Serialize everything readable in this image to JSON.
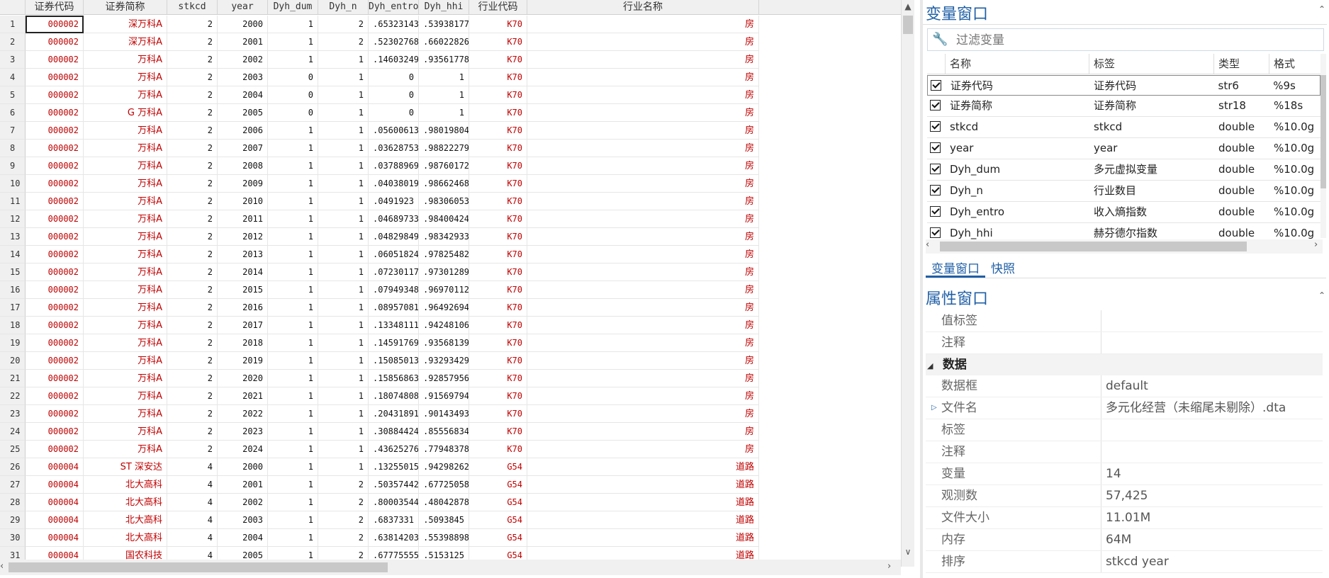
{
  "data_grid": {
    "columns": [
      "",
      "证券代码",
      "证券简称",
      "stkcd",
      "year",
      "Dyh_dum",
      "Dyh_n",
      "Dyh_entro",
      "Dyh_hhi",
      "行业代码",
      "行业名称"
    ],
    "rows": [
      [
        "1",
        "000002",
        "深万科A",
        "2",
        "2000",
        "1",
        "2",
        ".65323143",
        ".53938177",
        "K70",
        "房"
      ],
      [
        "2",
        "000002",
        "深万科A",
        "2",
        "2001",
        "1",
        "2",
        ".52302768",
        ".66022826",
        "K70",
        "房"
      ],
      [
        "3",
        "000002",
        "万科A",
        "2",
        "2002",
        "1",
        "1",
        ".14603249",
        ".93561778",
        "K70",
        "房"
      ],
      [
        "4",
        "000002",
        "万科A",
        "2",
        "2003",
        "0",
        "1",
        "0",
        "1",
        "K70",
        "房"
      ],
      [
        "5",
        "000002",
        "万科A",
        "2",
        "2004",
        "0",
        "1",
        "0",
        "1",
        "K70",
        "房"
      ],
      [
        "6",
        "000002",
        "G 万科A",
        "2",
        "2005",
        "0",
        "1",
        "0",
        "1",
        "K70",
        "房"
      ],
      [
        "7",
        "000002",
        "万科A",
        "2",
        "2006",
        "1",
        "1",
        ".05600613",
        ".98019804",
        "K70",
        "房"
      ],
      [
        "8",
        "000002",
        "万科A",
        "2",
        "2007",
        "1",
        "1",
        ".03628753",
        ".98822279",
        "K70",
        "房"
      ],
      [
        "9",
        "000002",
        "万科A",
        "2",
        "2008",
        "1",
        "1",
        ".03788969",
        ".98760172",
        "K70",
        "房"
      ],
      [
        "10",
        "000002",
        "万科A",
        "2",
        "2009",
        "1",
        "1",
        ".04038019",
        ".98662468",
        "K70",
        "房"
      ],
      [
        "11",
        "000002",
        "万科A",
        "2",
        "2010",
        "1",
        "1",
        ".0491923",
        ".98306053",
        "K70",
        "房"
      ],
      [
        "12",
        "000002",
        "万科A",
        "2",
        "2011",
        "1",
        "1",
        ".04689733",
        ".98400424",
        "K70",
        "房"
      ],
      [
        "13",
        "000002",
        "万科A",
        "2",
        "2012",
        "1",
        "1",
        ".04829849",
        ".98342933",
        "K70",
        "房"
      ],
      [
        "14",
        "000002",
        "万科A",
        "2",
        "2013",
        "1",
        "1",
        ".06051824",
        ".97825482",
        "K70",
        "房"
      ],
      [
        "15",
        "000002",
        "万科A",
        "2",
        "2014",
        "1",
        "1",
        ".07230117",
        ".97301289",
        "K70",
        "房"
      ],
      [
        "16",
        "000002",
        "万科A",
        "2",
        "2015",
        "1",
        "1",
        ".07949348",
        ".96970112",
        "K70",
        "房"
      ],
      [
        "17",
        "000002",
        "万科A",
        "2",
        "2016",
        "1",
        "1",
        ".08957081",
        ".96492694",
        "K70",
        "房"
      ],
      [
        "18",
        "000002",
        "万科A",
        "2",
        "2017",
        "1",
        "1",
        ".13348111",
        ".94248106",
        "K70",
        "房"
      ],
      [
        "19",
        "000002",
        "万科A",
        "2",
        "2018",
        "1",
        "1",
        ".14591769",
        ".93568139",
        "K70",
        "房"
      ],
      [
        "20",
        "000002",
        "万科A",
        "2",
        "2019",
        "1",
        "1",
        ".15085013",
        ".93293429",
        "K70",
        "房"
      ],
      [
        "21",
        "000002",
        "万科A",
        "2",
        "2020",
        "1",
        "1",
        ".15856863",
        ".92857956",
        "K70",
        "房"
      ],
      [
        "22",
        "000002",
        "万科A",
        "2",
        "2021",
        "1",
        "1",
        ".18074808",
        ".91569794",
        "K70",
        "房"
      ],
      [
        "23",
        "000002",
        "万科A",
        "2",
        "2022",
        "1",
        "1",
        ".20431891",
        ".90143493",
        "K70",
        "房"
      ],
      [
        "24",
        "000002",
        "万科A",
        "2",
        "2023",
        "1",
        "1",
        ".30884424",
        ".85556834",
        "K70",
        "房"
      ],
      [
        "25",
        "000002",
        "万科A",
        "2",
        "2024",
        "1",
        "1",
        ".43625276",
        ".77948378",
        "K70",
        "房"
      ],
      [
        "26",
        "000004",
        "ST 深安达",
        "4",
        "2000",
        "1",
        "1",
        ".13255015",
        ".94298262",
        "G54",
        "道路"
      ],
      [
        "27",
        "000004",
        "北大高科",
        "4",
        "2001",
        "1",
        "2",
        ".50357442",
        ".67725058",
        "G54",
        "道路"
      ],
      [
        "28",
        "000004",
        "北大高科",
        "4",
        "2002",
        "1",
        "2",
        ".80003544",
        ".48042878",
        "G54",
        "道路"
      ],
      [
        "29",
        "000004",
        "北大高科",
        "4",
        "2003",
        "1",
        "2",
        ".6837331",
        ".5093845",
        "G54",
        "道路"
      ],
      [
        "30",
        "000004",
        "北大高科",
        "4",
        "2004",
        "1",
        "2",
        ".63814203",
        ".55398898",
        "G54",
        "道路"
      ],
      [
        "31",
        "000004",
        "国农科技",
        "4",
        "2005",
        "1",
        "2",
        ".67775555",
        ".5153125",
        "G54",
        "道路"
      ]
    ]
  },
  "variables_pane": {
    "title": "变量窗口",
    "filter_placeholder": "过滤变量",
    "headers": [
      "名称",
      "标签",
      "类型",
      "格式"
    ],
    "rows": [
      [
        "证券代码",
        "证券代码",
        "str6",
        "%9s"
      ],
      [
        "证券简称",
        "证券简称",
        "str18",
        "%18s"
      ],
      [
        "stkcd",
        "stkcd",
        "double",
        "%10.0g"
      ],
      [
        "year",
        "year",
        "double",
        "%10.0g"
      ],
      [
        "Dyh_dum",
        "多元虚拟变量",
        "double",
        "%10.0g"
      ],
      [
        "Dyh_n",
        "行业数目",
        "double",
        "%10.0g"
      ],
      [
        "Dyh_entro",
        "收入熵指数",
        "double",
        "%10.0g"
      ],
      [
        "Dyh_hhi",
        "赫芬德尔指数",
        "double",
        "%10.0g"
      ]
    ],
    "tabs": [
      "变量窗口",
      "快照"
    ]
  },
  "properties_pane": {
    "title": "属性窗口",
    "top_rows": [
      {
        "key": "值标签",
        "value": ""
      },
      {
        "key": "注释",
        "value": ""
      }
    ],
    "section": "数据",
    "data_rows": [
      {
        "key": "数据框",
        "value": "default"
      },
      {
        "key": "文件名",
        "value": "多元化经营（未缩尾未剔除）.dta"
      },
      {
        "key": "标签",
        "value": ""
      },
      {
        "key": "注释",
        "value": ""
      },
      {
        "key": "变量",
        "value": "14"
      },
      {
        "key": "观测数",
        "value": "57,425"
      },
      {
        "key": "文件大小",
        "value": "11.01M"
      },
      {
        "key": "内存",
        "value": "64M"
      },
      {
        "key": "排序",
        "value": "stkcd year"
      }
    ]
  },
  "colors": {
    "accent": "#1f5fa6",
    "string_red": "#c00000"
  },
  "icons": {
    "filter": "wrench-icon"
  }
}
